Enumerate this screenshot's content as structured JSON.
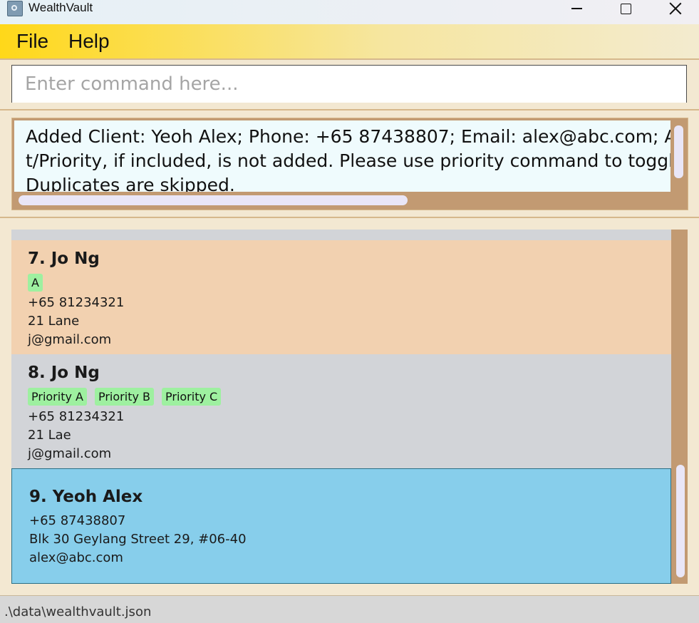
{
  "window": {
    "title": "WealthVault",
    "icon": "app-icon",
    "controls": [
      "minimize-icon",
      "maximize-icon",
      "close-icon"
    ]
  },
  "menu": {
    "items": [
      {
        "label": "File"
      },
      {
        "label": "Help"
      }
    ]
  },
  "command": {
    "placeholder": "Enter command here...",
    "value": ""
  },
  "result": {
    "lines": [
      "Added Client: Yeoh Alex; Phone: +65 87438807; Email: alex@abc.com; Ac",
      "t/Priority, if included, is not added. Please use priority command to toggl",
      "Duplicates are skipped."
    ]
  },
  "clients": [
    {
      "heading": "7. Jo Ng",
      "tags": [
        "A"
      ],
      "phone": "+65 81234321",
      "address": "21 Lane",
      "email": "j@gmail.com",
      "background": "#f2d1b0",
      "selected": false
    },
    {
      "heading": "8. Jo Ng",
      "tags": [
        "Priority A",
        "Priority B",
        "Priority C"
      ],
      "phone": "+65 81234321",
      "address": "21 Lae",
      "email": "j@gmail.com",
      "background": "#d2d4d8",
      "selected": false
    },
    {
      "heading": "9. Yeoh Alex",
      "tags": [],
      "phone": "+65 87438807",
      "address": "Blk 30 Geylang Street 29, #06-40",
      "email": "alex@abc.com",
      "background": "#87ceeb",
      "selected": true
    }
  ],
  "status": {
    "path": ".\\data\\wealthvault.json"
  },
  "colors": {
    "menu_accent": "#ffd819",
    "tag_bg": "#9ef0a0",
    "scroll_track": "#c29a72",
    "selected_border": "#2a6f86"
  }
}
